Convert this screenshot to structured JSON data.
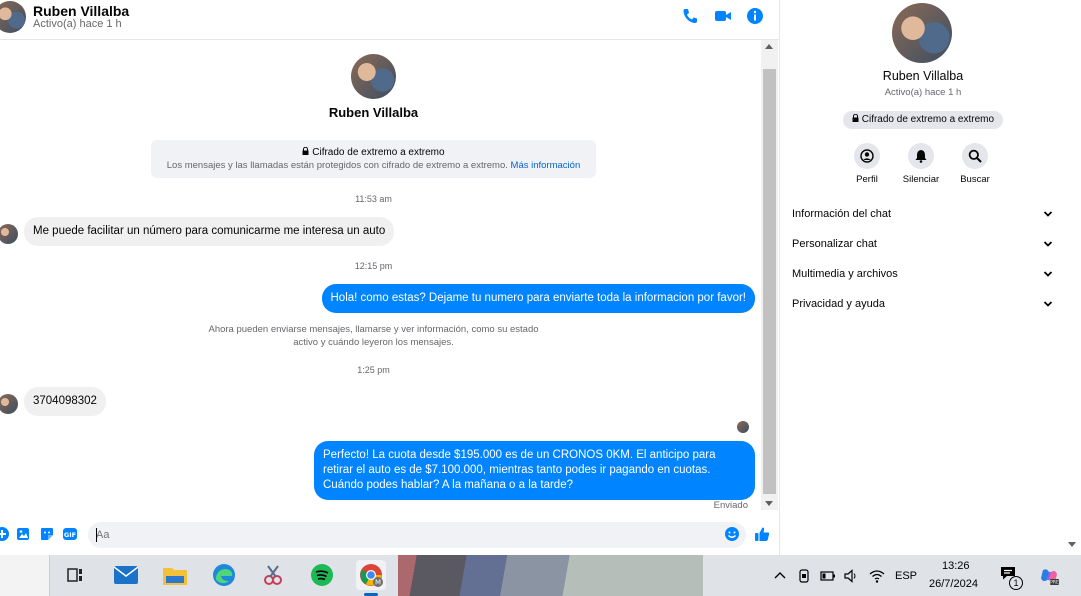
{
  "header": {
    "name": "Ruben Villalba",
    "status": "Activo(a) hace 1 h"
  },
  "conversation": {
    "name": "Ruben Villalba",
    "e2e_title": "Cifrado de extremo a extremo",
    "e2e_text": "Los mensajes y las llamadas están protegidos con cifrado de extremo a extremo.",
    "e2e_link": "Más información",
    "time1": "11:53 am",
    "msg1": "Me puede facilitar un número para comunicarme me interesa un auto",
    "time2": "12:15 pm",
    "msg2": "Hola! como estas? Dejame tu numero para enviarte toda la informacion por favor!",
    "system_note": "Ahora pueden enviarse mensajes, llamarse y ver información, como su estado activo y cuándo leyeron los mensajes.",
    "time3": "1:25 pm",
    "msg3": "3704098302",
    "msg4": "Perfecto! La cuota desde $195.000 es de un CRONOS 0KM. El anticipo para retirar el auto es de $7.100.000, mientras tanto podes ir pagando en cuotas. Cuándo podes hablar? A la mañana o a la tarde?",
    "sent_label": "Enviado"
  },
  "composer": {
    "placeholder": "Aa"
  },
  "panel": {
    "name": "Ruben Villalba",
    "status": "Activo(a) hace 1 h",
    "e2e_badge": "Cifrado de extremo a extremo",
    "actions": [
      "Perfil",
      "Silenciar",
      "Buscar"
    ],
    "sections": [
      "Información del chat",
      "Personalizar chat",
      "Multimedia y archivos",
      "Privacidad y ayuda"
    ]
  },
  "taskbar": {
    "language": "ESP",
    "time": "13:26",
    "date": "26/7/2024",
    "notification_count": "1"
  },
  "colors": {
    "accent": "#0084ff",
    "incoming_bubble": "#f0f0f0"
  }
}
